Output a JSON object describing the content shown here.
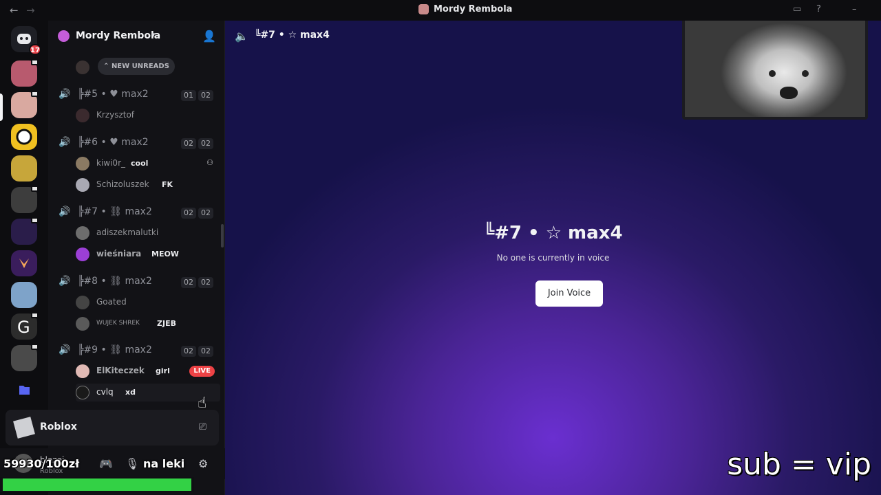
{
  "window": {
    "title": "Mordy Rembola",
    "nav_back": "←",
    "nav_forward": "→"
  },
  "guilds": {
    "home_badge": "17"
  },
  "server": {
    "name": "Mordy Rembola",
    "new_unreads": "NEW UNREADS"
  },
  "voice_channels": [
    {
      "name": "╠#5 • ♥ max2",
      "count_a": "01",
      "count_b": "02",
      "users": [
        {
          "name": "Krzysztof",
          "tag": ""
        }
      ]
    },
    {
      "name": "╠#6 • ♥ max2",
      "count_a": "02",
      "count_b": "02",
      "users": [
        {
          "name": "kiwi0r_",
          "tag": "cool"
        },
        {
          "name": "Schizoluszek",
          "tag": "FK"
        }
      ]
    },
    {
      "name": "╠#7 • ⛓ max2",
      "count_a": "02",
      "count_b": "02",
      "users": [
        {
          "name": "adiszekmalutki",
          "tag": ""
        },
        {
          "name": "wieśniara",
          "tag": "MEOW"
        }
      ]
    },
    {
      "name": "╠#8 • ⛓ max2",
      "count_a": "02",
      "count_b": "02",
      "users": [
        {
          "name": "Goated",
          "tag": ""
        },
        {
          "name": "WUJEK SHREK",
          "tag": "ZJEB"
        }
      ]
    },
    {
      "name": "╠#9 • ⛓ max2",
      "count_a": "02",
      "count_b": "02",
      "users": [
        {
          "name": "ElKiteczek",
          "tag": "girl"
        },
        {
          "name": "cvlq",
          "tag": "xd"
        }
      ]
    }
  ],
  "live_label": "LIVE",
  "activity": {
    "game": "Roblox"
  },
  "user_panel": {
    "username": "blazej",
    "status": "Roblox"
  },
  "overlay": {
    "money": "59930/100zł",
    "label": "na leki",
    "subvip": "sub = vip",
    "goal_progress": 1.0
  },
  "main": {
    "header_title": "╚#7 • ☆ max4",
    "center_title": "╚#7 • ☆ max4",
    "center_subtitle": "No one is currently in voice",
    "join_button": "Join Voice"
  },
  "colors": {
    "accent": "#5865f2",
    "voice_green": "#3ba55c",
    "live_red": "#ed4245",
    "progress_green": "#33d145"
  }
}
